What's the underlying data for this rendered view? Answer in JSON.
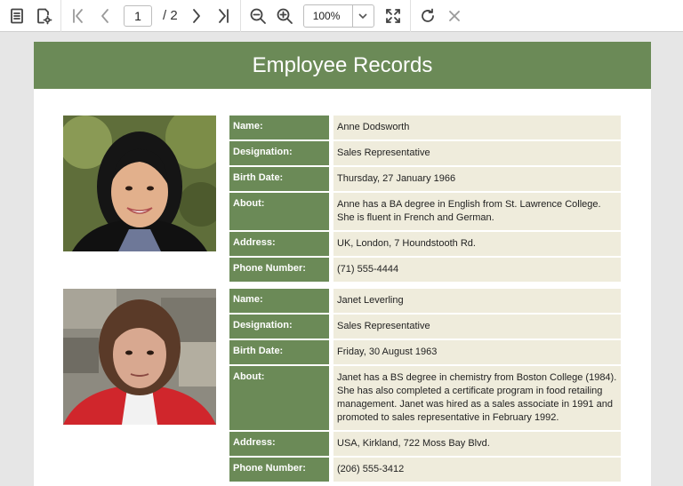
{
  "toolbar": {
    "page_current": "1",
    "page_total": "/ 2",
    "zoom_value": "100%"
  },
  "report": {
    "title": "Employee Records"
  },
  "employees": [
    {
      "labels": [
        "Name:",
        "Designation:",
        "Birth Date:",
        "About:",
        "Address:",
        "Phone Number:"
      ],
      "values": [
        "Anne Dodsworth",
        "Sales Representative",
        "Thursday, 27 January 1966",
        "Anne has a BA degree in English from St. Lawrence College.  She is fluent in French and German.",
        "UK, London, 7 Houndstooth Rd.",
        "(71) 555-4444"
      ]
    },
    {
      "labels": [
        "Name:",
        "Designation:",
        "Birth Date:",
        "About:",
        "Address:",
        "Phone Number:"
      ],
      "values": [
        "Janet Leverling",
        "Sales Representative",
        "Friday, 30 August 1963",
        "Janet has a BS degree in chemistry from Boston College (1984).  She has also completed a certificate program in food retailing management.  Janet was hired as a sales associate in 1991 and promoted to sales representative in February 1992.",
        "USA, Kirkland, 722 Moss Bay Blvd.",
        "(206) 555-3412"
      ]
    }
  ],
  "colors": {
    "header_green": "#6b8a57",
    "value_bg": "#efecdc"
  }
}
